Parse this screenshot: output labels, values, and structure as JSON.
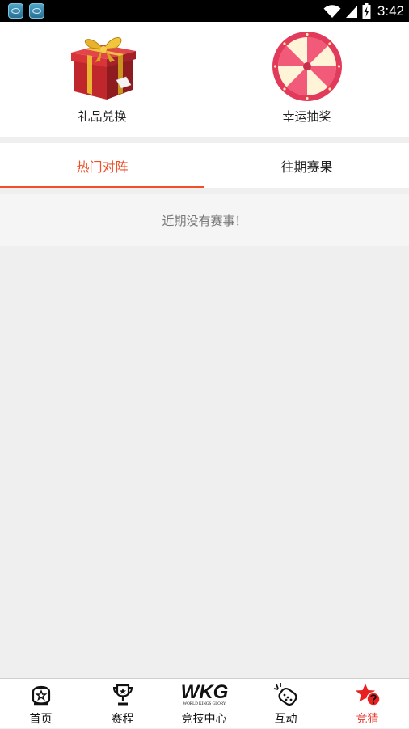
{
  "status_bar": {
    "time": "3:42",
    "icons": [
      "app-notification-icon",
      "app-notification-icon",
      "wifi-icon",
      "signal-icon",
      "battery-charging-icon"
    ]
  },
  "top_cards": [
    {
      "label": "礼品兑换",
      "icon": "gift-box-icon"
    },
    {
      "label": "幸运抽奖",
      "icon": "lucky-wheel-icon"
    }
  ],
  "tabs": [
    {
      "label": "热门对阵",
      "active": true
    },
    {
      "label": "往期赛果",
      "active": false
    }
  ],
  "empty_message": "近期没有赛事！",
  "bottom_nav": [
    {
      "label": "首页",
      "icon": "helmet-icon"
    },
    {
      "label": "赛程",
      "icon": "trophy-icon"
    },
    {
      "label": "竞技中心",
      "icon": "wkg-logo",
      "logo_text": "WKG",
      "logo_subtext": "WORLD KINGS GLORY"
    },
    {
      "label": "互动",
      "icon": "interaction-icon"
    },
    {
      "label": "竞猜",
      "icon": "guess-icon",
      "active": true
    }
  ],
  "colors": {
    "accent": "#f04f2a",
    "nav_active": "#e8342a",
    "background": "#efefef"
  }
}
